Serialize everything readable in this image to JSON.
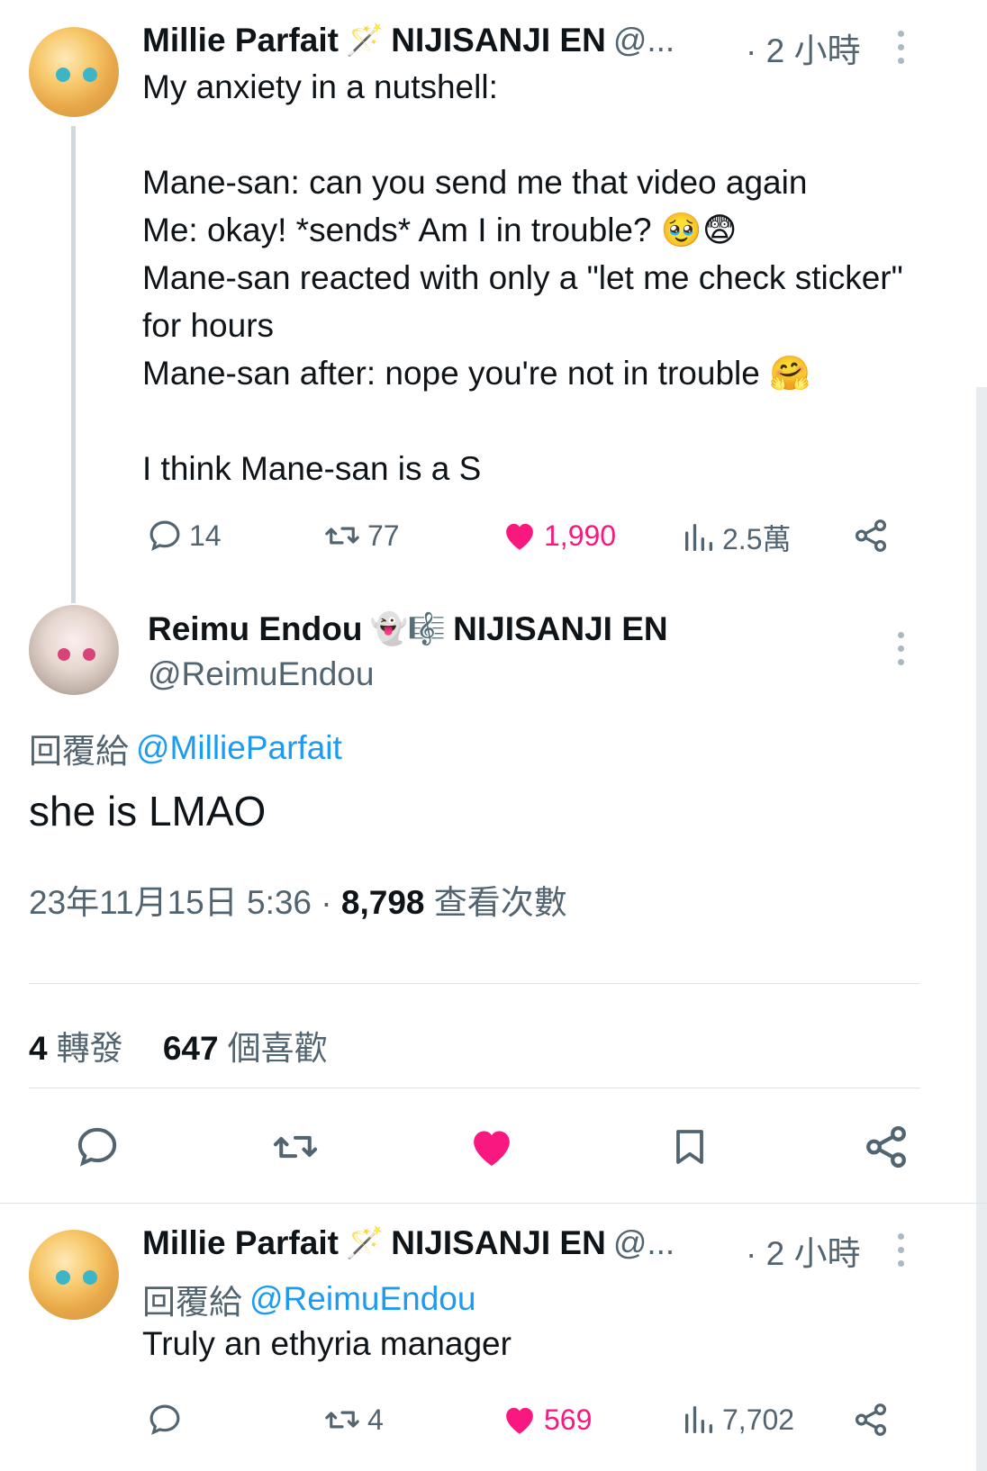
{
  "tweet1": {
    "name": "Millie Parfait",
    "name_emoji": "🪄",
    "org": "NIJISANJI EN",
    "handle": "@...",
    "time": "· 2 小時",
    "text": "My anxiety in a nutshell:\n\nMane-san: can you send me that video again\nMe: okay! *sends* Am I in trouble? 🥹😨\nMane-san reacted with only a \"let me check sticker\" for hours\nMane-san after: nope you're not in trouble 🤗\n\nI think Mane-san is a S",
    "replies": "14",
    "retweets": "77",
    "likes": "1,990",
    "views": "2.5萬"
  },
  "main": {
    "name": "Reimu Endou",
    "name_emojis": "👻🎼",
    "org": "NIJISANJI EN",
    "handle": "@ReimuEndou",
    "reply_prefix": "回覆給",
    "reply_to": "@MillieParfait",
    "text": "she is LMAO",
    "date": "23年11月15日 5:36 · ",
    "views_count": "8,798",
    "views_label": " 查看次數",
    "retweets_count": "4",
    "retweets_label": "轉發",
    "likes_count": "647",
    "likes_label": "個喜歡"
  },
  "tweet3": {
    "name": "Millie Parfait",
    "name_emoji": "🪄",
    "org": "NIJISANJI EN",
    "handle": "@...",
    "time": "· 2 小時",
    "reply_prefix": "回覆給",
    "reply_to": "@ReimuEndou",
    "text": "Truly an ethyria manager",
    "replies": "",
    "retweets": "4",
    "likes": "569",
    "views": "7,702"
  },
  "colors": {
    "like": "#f91880",
    "link": "#1d9bf0",
    "secondary": "#536471"
  },
  "icons": [
    "reply-icon",
    "retweet-icon",
    "heart-icon",
    "views-icon",
    "share-icon",
    "bookmark-icon",
    "more-icon"
  ]
}
